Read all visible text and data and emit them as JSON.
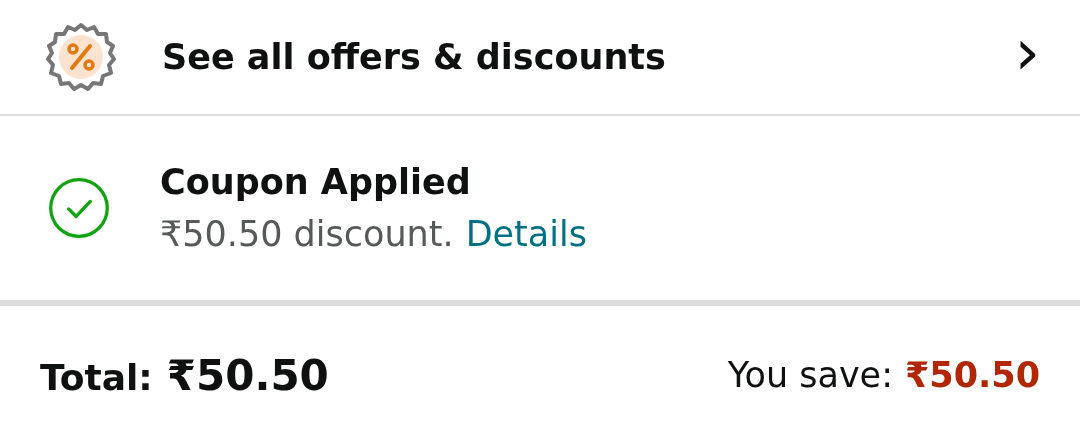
{
  "offers_row": {
    "label": "See all offers & discounts",
    "chevron": "›"
  },
  "coupon": {
    "title": "Coupon Applied",
    "discount": "₹50.50 discount.",
    "link": "Details"
  },
  "summary": {
    "total_label": "Total:",
    "total_amount": "₹50.50",
    "save_label": "You save:",
    "save_amount": "₹50.50"
  }
}
